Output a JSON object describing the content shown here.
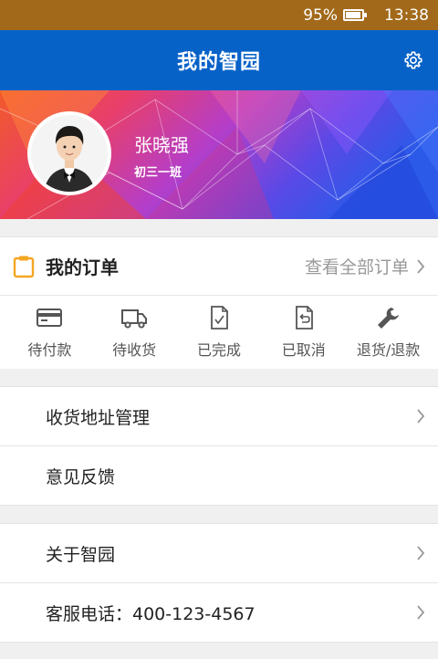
{
  "status_bar": {
    "battery_text": "95%",
    "battery_level": 0.95,
    "time": "13:38"
  },
  "nav": {
    "title": "我的智园",
    "settings_icon": "gear-icon"
  },
  "profile": {
    "name": "张晓强",
    "class_name": "初三一班"
  },
  "orders": {
    "title": "我的订单",
    "view_all": "查看全部订单",
    "icon_color": "#f5a623",
    "tabs": [
      {
        "label": "待付款",
        "icon": "card-icon"
      },
      {
        "label": "待收货",
        "icon": "truck-icon"
      },
      {
        "label": "已完成",
        "icon": "document-check-icon"
      },
      {
        "label": "已取消",
        "icon": "document-undo-icon"
      },
      {
        "label": "退货/退款",
        "icon": "wrench-icon"
      }
    ]
  },
  "menu": {
    "group1": [
      {
        "label": "收货地址管理",
        "chevron": true
      },
      {
        "label": "意见反馈",
        "chevron": false
      }
    ],
    "group2": [
      {
        "label": "关于智园",
        "chevron": true
      },
      {
        "label": "客服电话：400-123-4567",
        "chevron": true
      }
    ]
  },
  "colors": {
    "status_bar": "#a2691a",
    "nav_bar": "#0762c8",
    "accent_orange": "#f5a623"
  }
}
